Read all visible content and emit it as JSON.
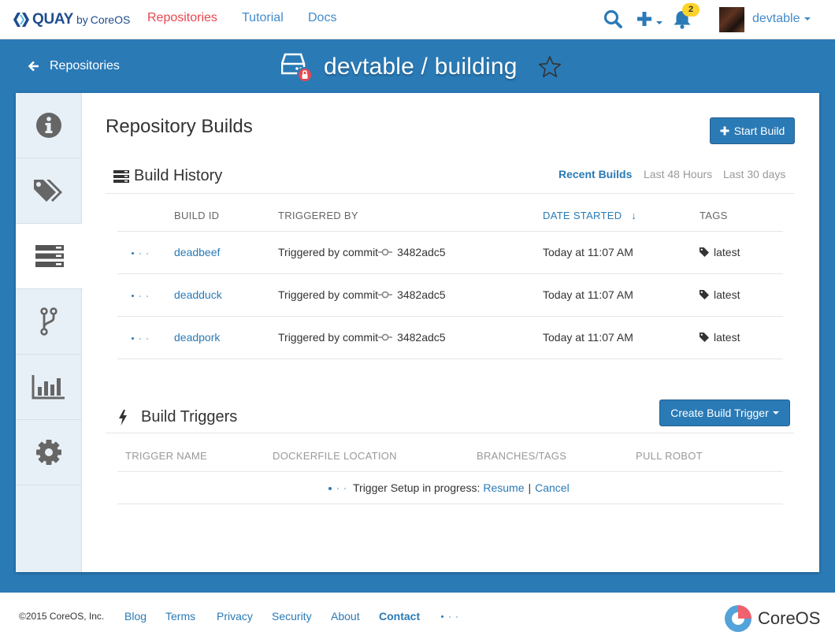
{
  "topnav": {
    "logo_text": "QUAY",
    "logo_by": "by",
    "logo_vendor": "CoreOS",
    "links": [
      "Repositories",
      "Tutorial",
      "Docs"
    ],
    "notification_count": "2",
    "username": "devtable"
  },
  "header": {
    "back_label": "Repositories",
    "repo_name": "devtable / building"
  },
  "page": {
    "title": "Repository Builds",
    "start_build_label": "Start Build"
  },
  "build_history": {
    "title": "Build History",
    "filters": [
      "Recent Builds",
      "Last 48 Hours",
      "Last 30 days"
    ],
    "active_filter": "Recent Builds",
    "columns": [
      "BUILD ID",
      "TRIGGERED BY",
      "DATE STARTED",
      "TAGS"
    ],
    "rows": [
      {
        "build_id": "deadbeef",
        "triggered_by": "Triggered by commit",
        "commit": "3482adc5",
        "date": "Today at 11:07 AM",
        "tag": "latest"
      },
      {
        "build_id": "deadduck",
        "triggered_by": "Triggered by commit",
        "commit": "3482adc5",
        "date": "Today at 11:07 AM",
        "tag": "latest"
      },
      {
        "build_id": "deadpork",
        "triggered_by": "Triggered by commit",
        "commit": "3482adc5",
        "date": "Today at 11:07 AM",
        "tag": "latest"
      }
    ]
  },
  "build_triggers": {
    "title": "Build Triggers",
    "create_label": "Create Build Trigger",
    "columns": [
      "TRIGGER NAME",
      "DOCKERFILE LOCATION",
      "BRANCHES/TAGS",
      "PULL ROBOT"
    ],
    "setup_text": "Trigger Setup in progress:",
    "resume_label": "Resume",
    "separator": "|",
    "cancel_label": "Cancel"
  },
  "footer": {
    "copyright": "©2015 CoreOS, Inc.",
    "links": [
      "Blog",
      "Terms",
      "Privacy",
      "Security",
      "About",
      "Contact"
    ],
    "brand": "CoreOS"
  },
  "colors": {
    "accent": "#2a7ab6",
    "active_nav": "#e9464f",
    "badge": "#fcd32a"
  }
}
